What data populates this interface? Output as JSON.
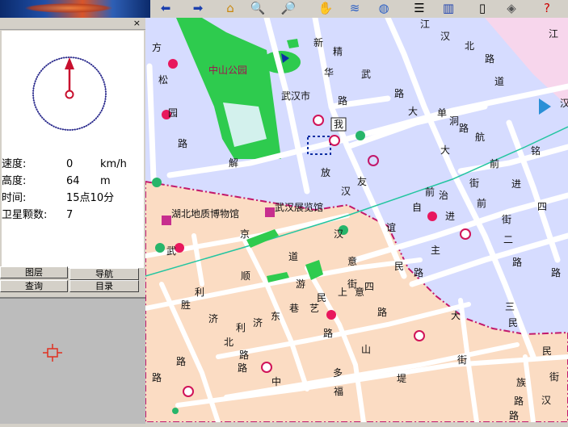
{
  "left_panel": {
    "close_glyph": "×",
    "status": {
      "speed": {
        "label": "速度:",
        "value": "0",
        "unit": "km/h"
      },
      "altitude": {
        "label": "高度:",
        "value": "64",
        "unit": "m"
      },
      "time": {
        "label": "时间:",
        "value": "15点10分"
      },
      "satellites": {
        "label": "卫星颗数:",
        "value": "7"
      }
    },
    "buttons": {
      "layers": "图层",
      "navigation": "导航",
      "query": "查询",
      "catalog": "目录"
    }
  },
  "toolbar": {
    "icons": [
      "arrow-left-icon",
      "arrow-right-icon",
      "home-icon",
      "zoom-in-icon",
      "zoom-out-icon",
      "hand-pan-icon",
      "layers-icon",
      "globe-icon",
      "list-icon",
      "bar-chart-icon",
      "clipboard-icon",
      "box-icon",
      "help-icon"
    ]
  },
  "map": {
    "park_label": "中山公园",
    "district_label": "武汉市",
    "museum_label": "湖北地质博物馆",
    "exhibition_label": "武汉展览馆",
    "me_marker": "我",
    "street_chars": [
      {
        "t": "江"
      },
      {
        "t": "汉"
      },
      {
        "t": "北"
      },
      {
        "t": "路"
      },
      {
        "t": "道"
      },
      {
        "t": "新"
      },
      {
        "t": "精"
      },
      {
        "t": "华"
      },
      {
        "t": "武"
      },
      {
        "t": "路"
      },
      {
        "t": "路"
      },
      {
        "t": "大"
      },
      {
        "t": "单"
      },
      {
        "t": "洞"
      },
      {
        "t": "路"
      },
      {
        "t": "航"
      },
      {
        "t": "大"
      },
      {
        "t": "前"
      },
      {
        "t": "铭"
      },
      {
        "t": "方"
      },
      {
        "t": "松"
      },
      {
        "t": "园"
      },
      {
        "t": "路"
      },
      {
        "t": "解"
      },
      {
        "t": "放"
      },
      {
        "t": "汉"
      },
      {
        "t": "友"
      },
      {
        "t": "街"
      },
      {
        "t": "前"
      },
      {
        "t": "进"
      },
      {
        "t": "治"
      },
      {
        "t": "前"
      },
      {
        "t": "四"
      },
      {
        "t": "自"
      },
      {
        "t": "进"
      },
      {
        "t": "街"
      },
      {
        "t": "京"
      },
      {
        "t": "汉"
      },
      {
        "t": "谊"
      },
      {
        "t": "二"
      },
      {
        "t": "武"
      },
      {
        "t": "道"
      },
      {
        "t": "意"
      },
      {
        "t": "主"
      },
      {
        "t": "民"
      },
      {
        "t": "路"
      },
      {
        "t": "路"
      },
      {
        "t": "顺"
      },
      {
        "t": "游"
      },
      {
        "t": "街"
      },
      {
        "t": "上"
      },
      {
        "t": "四"
      },
      {
        "t": "民"
      },
      {
        "t": "意"
      },
      {
        "t": "路"
      },
      {
        "t": "路"
      },
      {
        "t": "利"
      },
      {
        "t": "胜"
      },
      {
        "t": "巷"
      },
      {
        "t": "东"
      },
      {
        "t": "艺"
      },
      {
        "t": "济"
      },
      {
        "t": "利"
      },
      {
        "t": "济"
      },
      {
        "t": "路"
      },
      {
        "t": "大"
      },
      {
        "t": "三"
      },
      {
        "t": "民"
      },
      {
        "t": "北"
      },
      {
        "t": "路"
      },
      {
        "t": "山"
      },
      {
        "t": "路"
      },
      {
        "t": "路"
      },
      {
        "t": "街"
      },
      {
        "t": "民"
      },
      {
        "t": "路"
      },
      {
        "t": "多"
      },
      {
        "t": "堤"
      },
      {
        "t": "中"
      },
      {
        "t": "福"
      },
      {
        "t": "族"
      },
      {
        "t": "街"
      },
      {
        "t": "路"
      },
      {
        "t": "路"
      },
      {
        "t": "汉"
      },
      {
        "t": "江"
      },
      {
        "t": "汉"
      }
    ]
  },
  "colors": {
    "park_green": "#2ecb4e",
    "district_blue": "#d6dcff",
    "district_peach": "#fbdcc3",
    "road": "#ffffff",
    "boundary": "#c2186b",
    "rail": "#23c5a0"
  }
}
